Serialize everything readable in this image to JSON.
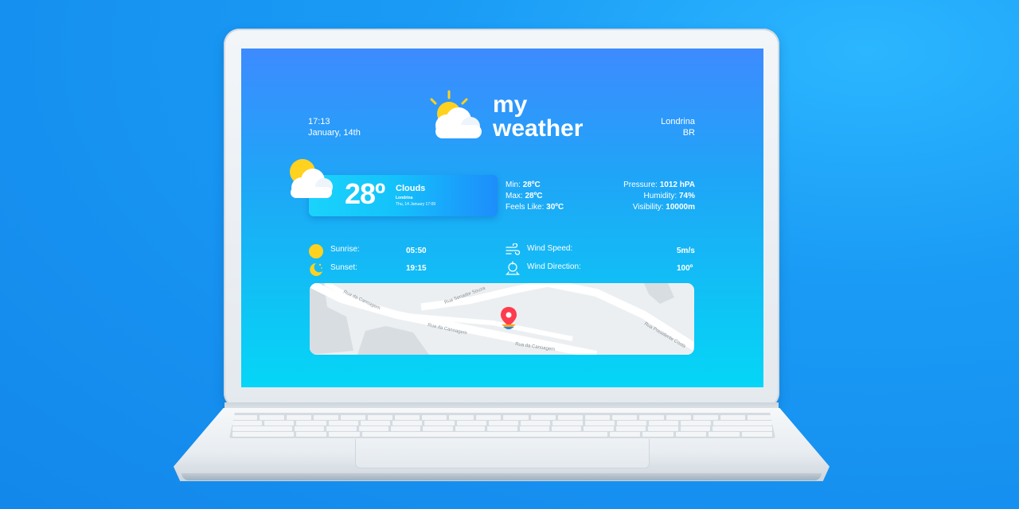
{
  "header": {
    "time": "17:13",
    "date": "January, 14th",
    "logo_line1": "my",
    "logo_line2": "weather",
    "city": "Londrina",
    "country": "BR"
  },
  "current": {
    "temperature": "28º",
    "condition": "Clouds",
    "city": "Londrina",
    "datetime": "Thu, 14 January 17:09",
    "min_label": "Min:",
    "min_value": "28ºC",
    "max_label": "Max:",
    "max_value": "28ºC",
    "feels_label": "Feels Like:",
    "feels_value": "30ºC",
    "pressure_label": "Pressure:",
    "pressure_value": "1012 hPA",
    "humidity_label": "Humidity:",
    "humidity_value": "74%",
    "visibility_label": "Visibility:",
    "visibility_value": "10000m"
  },
  "details": {
    "sunrise_label": "Sunrise:",
    "sunrise_value": "05:50",
    "sunset_label": "Sunset:",
    "sunset_value": "19:15",
    "wind_speed_label": "Wind Speed:",
    "wind_speed_value": "5m/s",
    "wind_direction_label": "Wind Direction:",
    "wind_direction_value": "100º"
  },
  "map": {
    "streets": [
      "Rua da Canoagem",
      "Rua Senador Souza",
      "Rua da Canoagem",
      "Rua da Canoagem",
      "Rua Presidente Costa"
    ]
  },
  "colors": {
    "background": "#1690f0",
    "screen_top": "#3d8bff",
    "screen_bottom": "#05d6f7",
    "card_left": "#1ad3fb",
    "card_right": "#1d8dfb",
    "sun": "#ffd21f",
    "pin": "#ff3b4e"
  },
  "icons": [
    "sun-cloud-icon",
    "sunrise-icon",
    "sunset-icon",
    "wind-icon",
    "wind-direction-icon",
    "map-pin-icon"
  ]
}
